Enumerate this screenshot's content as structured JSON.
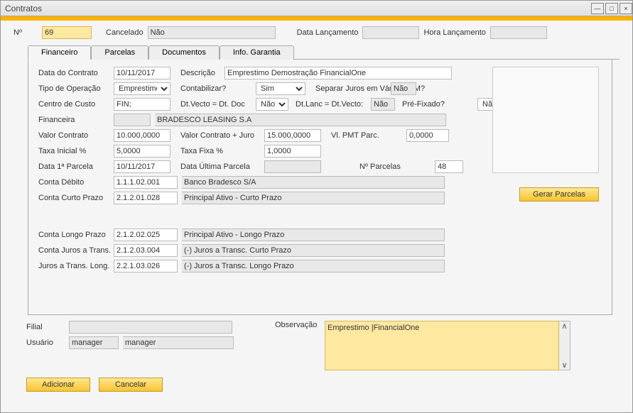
{
  "window": {
    "title": "Contratos"
  },
  "header": {
    "num_label": "Nº",
    "num_value": "69",
    "cancelado_label": "Cancelado",
    "cancelado_value": "Não",
    "datalanc_label": "Data Lançamento",
    "datalanc_value": "",
    "horalanc_label": "Hora Lançamento",
    "horalanc_value": ""
  },
  "tabs": {
    "financeiro": "Financeiro",
    "parcelas": "Parcelas",
    "documentos": "Documentos",
    "info_garantia": "Info. Garantia"
  },
  "form": {
    "data_contrato_label": "Data do Contrato",
    "data_contrato": "10/11/2017",
    "descricao_label": "Descrição",
    "descricao": "Emprestimo Demostração FinancialOne",
    "tipo_op_label": "Tipo de Operação",
    "tipo_op": "Emprestimo",
    "contabilizar_label": "Contabilizar?",
    "contabilizar": "Sim",
    "separar_label": "Separar Juros em Vários LCM?",
    "separar": "Não",
    "centro_label": "Centro de Custo",
    "centro": "FIN;",
    "dtvecto_label": "Dt.Vecto = Dt. Doc",
    "dtvecto": "Não",
    "dtlanc_label": "Dt.Lanc = Dt.Vecto:",
    "dtlanc": "Não",
    "prefixado_label": "Pré-Fixado?",
    "prefixado": "Não",
    "financeira_label": "Financeira",
    "financeira_code": "",
    "financeira_desc": "BRADESCO LEASING S.A",
    "valor_contrato_label": "Valor Contrato",
    "valor_contrato": "10.000,0000",
    "valor_juro_label": "Valor Contrato + Juro",
    "valor_juro": "15.000,0000",
    "vl_pmt_label": "Vl. PMT Parc.",
    "vl_pmt": "0,0000",
    "taxa_ini_label": "Taxa Inicial %",
    "taxa_ini": "5,0000",
    "taxa_fixa_label": "Taxa Fixa %",
    "taxa_fixa": "1,0000",
    "data1p_label": "Data 1ª Parcela",
    "data1p": "10/11/2017",
    "dataup_label": "Data Última Parcela",
    "dataup": "",
    "npar_label": "Nº Parcelas",
    "npar": "48",
    "conta_deb_label": "Conta Débito",
    "conta_deb": "1.1.1.02.001",
    "conta_deb_desc": "Banco Bradesco S/A",
    "conta_cp_label": "Conta Curto Prazo",
    "conta_cp": "2.1.2.01.028",
    "conta_cp_desc": "Principal Ativo - Curto Prazo",
    "conta_lp_label": "Conta Longo Prazo",
    "conta_lp": "2.1.2.02.025",
    "conta_lp_desc": "Principal Ativo - Longo Prazo",
    "conta_jt_label": "Conta Juros a Trans.",
    "conta_jt": "2.1.2.03.004",
    "conta_jt_desc": "(-) Juros a Transc. Curto Prazo",
    "juros_tl_label": "Juros a Trans. Long.",
    "juros_tl": "2.2.1.03.026",
    "juros_tl_desc": "(-) Juros a Transc. Longo Prazo",
    "gerar_parcelas": "Gerar Parcelas"
  },
  "footer": {
    "filial_label": "Filial",
    "filial": "",
    "usuario_label": "Usuário",
    "usuario_code": "manager",
    "usuario_name": "manager",
    "obs_label": "Observação",
    "obs": "Emprestimo |FinancialOne",
    "adicionar": "Adicionar",
    "cancelar": "Cancelar"
  }
}
